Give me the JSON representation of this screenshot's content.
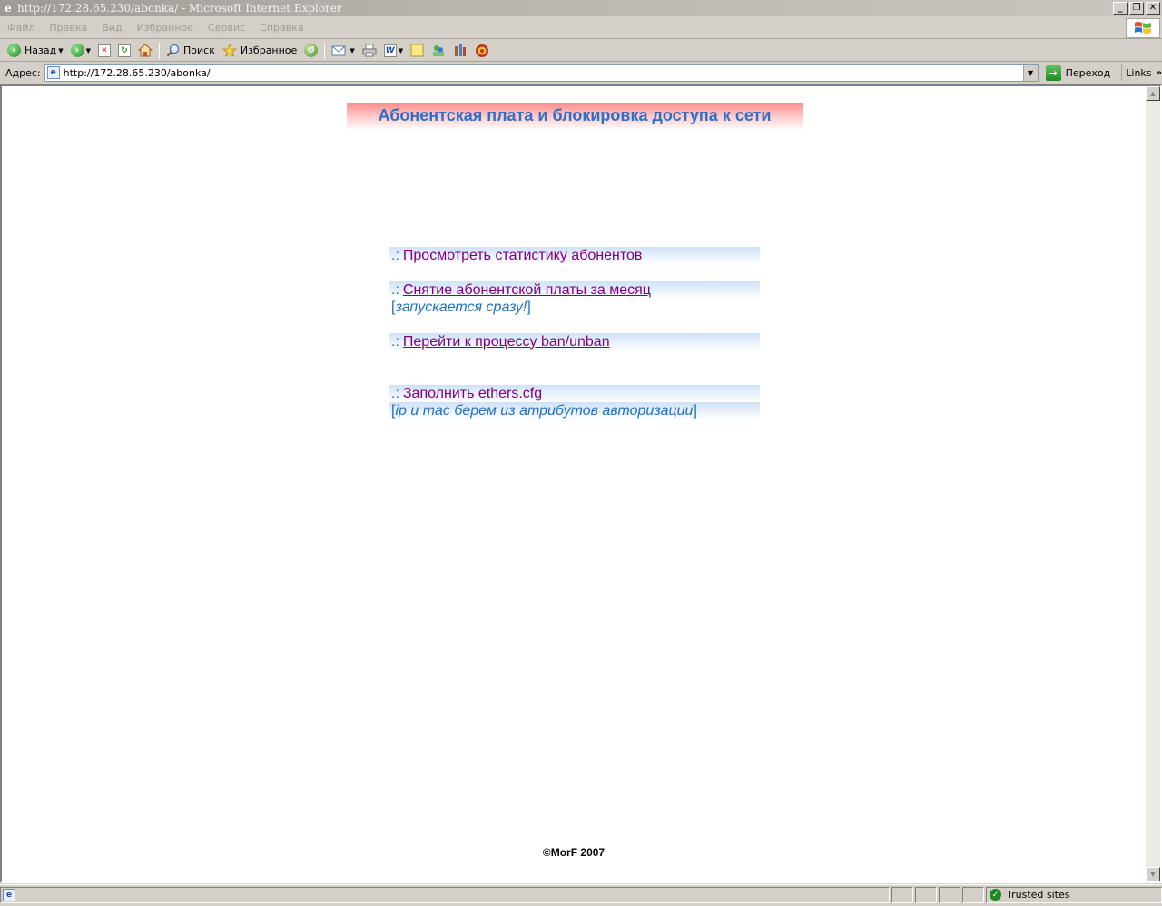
{
  "window": {
    "title": "http://172.28.65.230/abonka/ - Microsoft Internet Explorer",
    "minimize_label": "_",
    "restore_label": "❐",
    "close_label": "✕"
  },
  "menubar": {
    "items": [
      {
        "label": "Файл"
      },
      {
        "label": "Правка"
      },
      {
        "label": "Вид"
      },
      {
        "label": "Избранное"
      },
      {
        "label": "Сервис"
      },
      {
        "label": "Справка"
      }
    ]
  },
  "toolbar": {
    "back_label": "Назад",
    "search_label": "Поиск",
    "favorites_label": "Избранное"
  },
  "addressbar": {
    "label": "Адрес:",
    "url": "http://172.28.65.230/abonka/",
    "go_label": "Переход",
    "links_label": "Links"
  },
  "page": {
    "header": "Абонентская плата и блокировка доступа к сети",
    "bullet": ".:",
    "links": [
      {
        "label": "Просмотреть статистику абонентов"
      },
      {
        "label": "Снятие абонентской платы за месяц",
        "note": "запускается сразу!"
      },
      {
        "label": "Перейти к процессу ban/unban"
      },
      {
        "label": "Заполнить ethers.cfg",
        "note": "ip и mac берем из атрибутов авторизации"
      }
    ],
    "footer": "©MorF 2007"
  },
  "statusbar": {
    "zone": "Trusted sites"
  },
  "colors": {
    "header_text": "#2d70c8",
    "link_visited": "#800080",
    "note_text": "#1e6fc4"
  }
}
